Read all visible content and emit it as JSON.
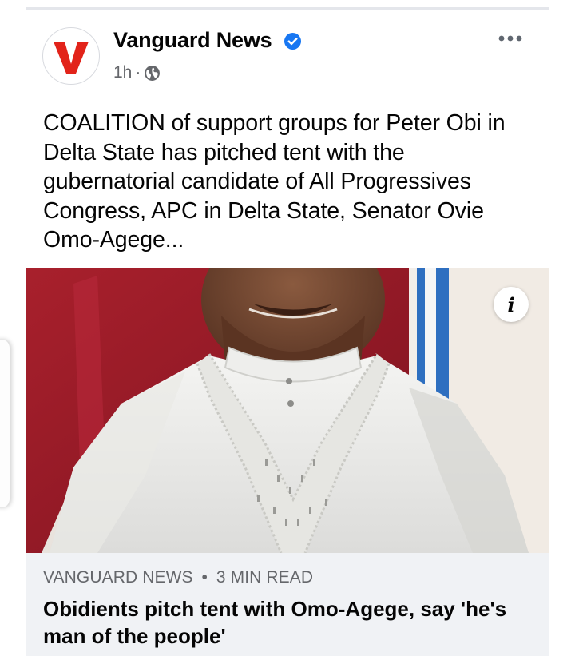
{
  "post": {
    "page_name": "Vanguard News",
    "avatar_letter": "V",
    "time": "1h",
    "separator": "·",
    "privacy_icon": "globe-icon",
    "verified_icon": "verified-badge-icon",
    "more_icon": "more-options-icon",
    "text": "COALITION of support groups for Peter Obi in Delta State has pitched tent with the gubernatorial candidate of All Progressives Congress, APC in Delta State, Senator Ovie Omo-Agege...",
    "info_button_label": "i"
  },
  "link_preview": {
    "source": "VANGUARD NEWS",
    "separator": "•",
    "read_time": "3 MIN READ",
    "title": "Obidients pitch tent with Omo-Agege, say 'he's man of the people'"
  },
  "colors": {
    "brand_red": "#e2231a",
    "verified_blue": "#1877f2",
    "secondary_text": "#65676b",
    "link_box_bg": "#f0f2f5"
  }
}
